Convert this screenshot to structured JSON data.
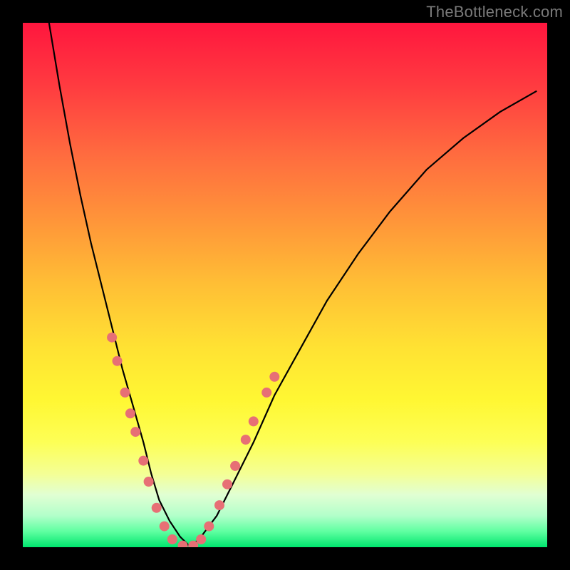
{
  "watermark": "TheBottleneck.com",
  "colors": {
    "page_bg": "#000000",
    "curve_stroke": "#000000",
    "marker_fill": "#e76f75",
    "gradient_top": "#ff163e",
    "gradient_bottom": "#00e66e"
  },
  "chart_data": {
    "type": "line",
    "title": "",
    "xlabel": "",
    "ylabel": "",
    "xlim": [
      0,
      100
    ],
    "ylim": [
      0,
      100
    ],
    "grid": false,
    "background": "vertical-gradient red→orange→yellow→green",
    "series": [
      {
        "name": "bottleneck-curve",
        "x": [
          5,
          7,
          9,
          11,
          13,
          15,
          17,
          19,
          21,
          23,
          24.5,
          26,
          28,
          30,
          32,
          34,
          37,
          40,
          44,
          48,
          53,
          58,
          64,
          70,
          77,
          84,
          91,
          98
        ],
        "values": [
          100,
          88,
          77,
          67,
          58,
          50,
          42,
          34,
          27,
          20,
          14,
          9,
          5,
          2,
          0,
          2,
          6,
          12,
          20,
          29,
          38,
          47,
          56,
          64,
          72,
          78,
          83,
          87
        ]
      }
    ],
    "markers": [
      {
        "x": 17.0,
        "y": 40.0
      },
      {
        "x": 18.0,
        "y": 35.5
      },
      {
        "x": 19.5,
        "y": 29.5
      },
      {
        "x": 20.5,
        "y": 25.5
      },
      {
        "x": 21.5,
        "y": 22.0
      },
      {
        "x": 23.0,
        "y": 16.5
      },
      {
        "x": 24.0,
        "y": 12.5
      },
      {
        "x": 25.5,
        "y": 7.5
      },
      {
        "x": 27.0,
        "y": 4.0
      },
      {
        "x": 28.5,
        "y": 1.5
      },
      {
        "x": 30.5,
        "y": 0.3
      },
      {
        "x": 32.5,
        "y": 0.3
      },
      {
        "x": 34.0,
        "y": 1.5
      },
      {
        "x": 35.5,
        "y": 4.0
      },
      {
        "x": 37.5,
        "y": 8.0
      },
      {
        "x": 39.0,
        "y": 12.0
      },
      {
        "x": 40.5,
        "y": 15.5
      },
      {
        "x": 42.5,
        "y": 20.5
      },
      {
        "x": 44.0,
        "y": 24.0
      },
      {
        "x": 46.5,
        "y": 29.5
      },
      {
        "x": 48.0,
        "y": 32.5
      }
    ]
  }
}
